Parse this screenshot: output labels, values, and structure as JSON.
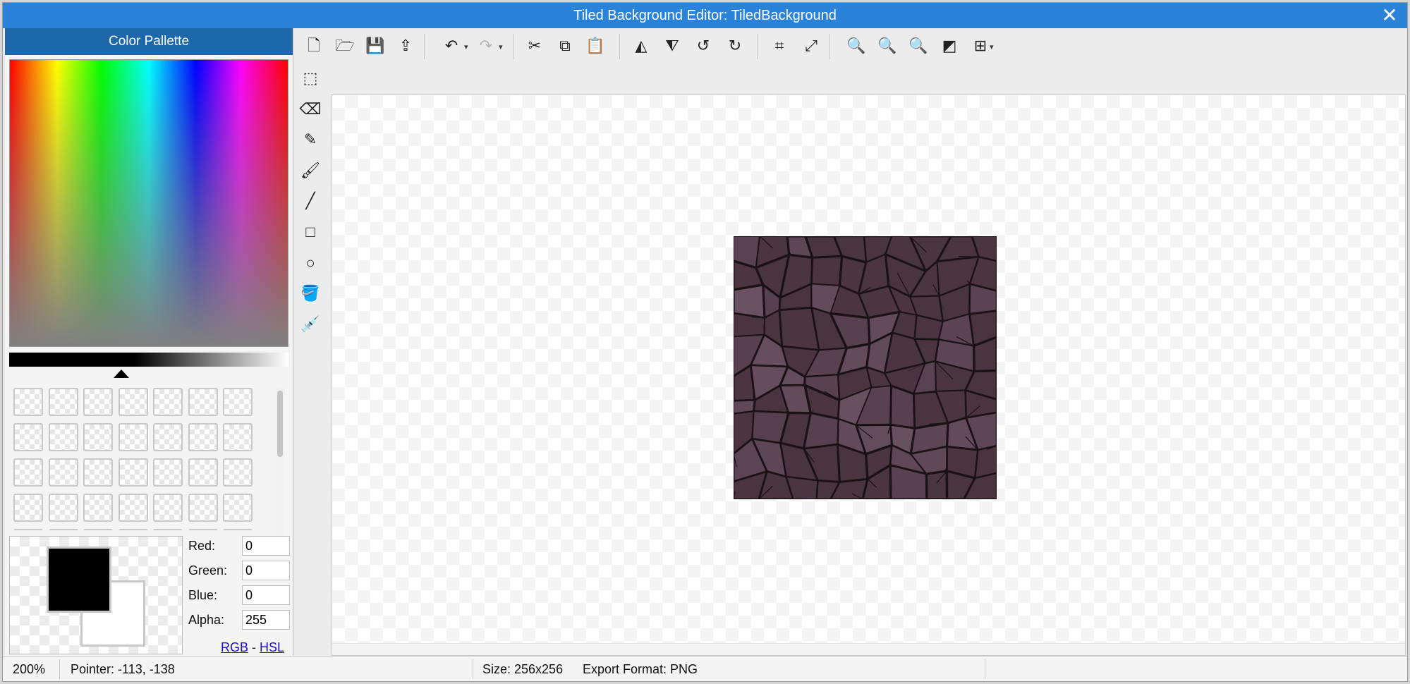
{
  "window": {
    "title": "Tiled Background Editor: TiledBackground",
    "close_glyph": "✕"
  },
  "palette": {
    "title": "Color Pallette",
    "labels": {
      "red": "Red:",
      "green": "Green:",
      "blue": "Blue:",
      "alpha": "Alpha:"
    },
    "values": {
      "red": "0",
      "green": "0",
      "blue": "0",
      "alpha": "255"
    },
    "foreground_color": "#000000",
    "background_color": "#ffffff",
    "mode_links": {
      "rgb": "RGB",
      "separator": "-",
      "hsl": "HSL"
    },
    "empty_swatch_rows_visible": 4,
    "swatches_per_row": 7
  },
  "toolbar": {
    "items": [
      {
        "name": "new-file-icon",
        "glyph": "🗋"
      },
      {
        "name": "open-folder-icon",
        "glyph": "🗁"
      },
      {
        "name": "save-icon",
        "glyph": "💾"
      },
      {
        "name": "export-icon",
        "glyph": "⇪"
      },
      {
        "name": "undo-icon",
        "glyph": "↶"
      },
      {
        "name": "redo-icon",
        "glyph": "↷"
      },
      {
        "name": "cut-icon",
        "glyph": "✂"
      },
      {
        "name": "copy-icon",
        "glyph": "⧉"
      },
      {
        "name": "paste-icon",
        "glyph": "📋"
      },
      {
        "name": "flip-horizontal-icon",
        "glyph": "◭"
      },
      {
        "name": "flip-vertical-icon",
        "glyph": "⧨"
      },
      {
        "name": "rotate-left-icon",
        "glyph": "↺"
      },
      {
        "name": "rotate-right-icon",
        "glyph": "↻"
      },
      {
        "name": "crop-icon",
        "glyph": "⌗"
      },
      {
        "name": "resize-icon",
        "glyph": "⤢"
      },
      {
        "name": "zoom-in-icon",
        "glyph": "🔍"
      },
      {
        "name": "zoom-out-icon",
        "glyph": "🔍"
      },
      {
        "name": "zoom-reset-icon",
        "glyph": "🔍"
      },
      {
        "name": "invert-icon",
        "glyph": "◩"
      },
      {
        "name": "grid-icon",
        "glyph": "⊞"
      }
    ],
    "dropdown_glyph": "▾"
  },
  "tools": [
    {
      "name": "select-tool-icon",
      "glyph": "⬚"
    },
    {
      "name": "eraser-tool-icon",
      "glyph": "⌫"
    },
    {
      "name": "pencil-tool-icon",
      "glyph": "✎"
    },
    {
      "name": "brush-tool-icon",
      "glyph": "🖌"
    },
    {
      "name": "line-tool-icon",
      "glyph": "╱"
    },
    {
      "name": "rectangle-tool-icon",
      "glyph": "□"
    },
    {
      "name": "ellipse-tool-icon",
      "glyph": "○"
    },
    {
      "name": "fill-tool-icon",
      "glyph": "🪣"
    },
    {
      "name": "eyedropper-tool-icon",
      "glyph": "💉"
    }
  ],
  "canvas": {
    "texture_colors": {
      "base": "#4a3540",
      "crack": "#1a1214",
      "highlight": "#6e5666"
    }
  },
  "status": {
    "zoom": "200%",
    "pointer": "Pointer: -113, -138",
    "size": "Size: 256x256",
    "export_format": "Export Format: PNG"
  }
}
